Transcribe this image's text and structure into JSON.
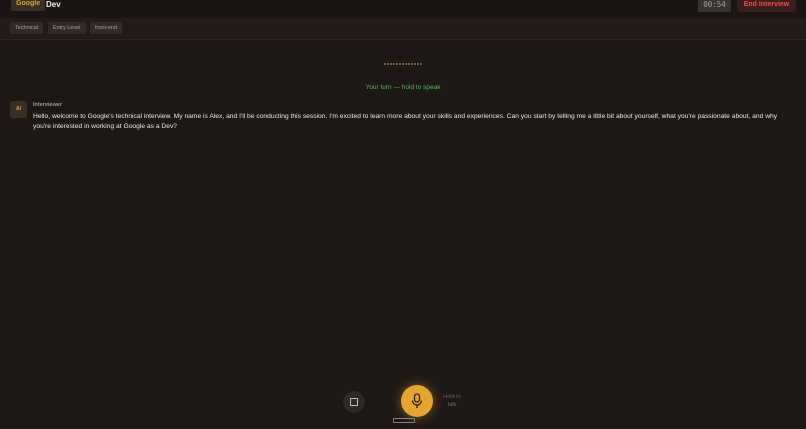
{
  "header": {
    "company": "Google",
    "role": "Dev",
    "timer": "00:54",
    "end_label": "End Interview"
  },
  "tags": [
    "Technical",
    "Entry Level",
    "front-end"
  ],
  "status": {
    "turn_text": "Your turn — hold to speak"
  },
  "transcript": {
    "avatar_label": "AI",
    "speaker": "Interviewer",
    "message": "Hello, welcome to Google's technical interview. My name is Alex, and I'll be conducting this session. I'm excited to learn more about your skills and experiences. Can you start by telling me a little bit about yourself, what you're passionate about, and why you're interested in working at Google as a Dev?"
  },
  "controls": {
    "stop_icon": "square-icon",
    "mic_icon": "microphone-icon",
    "hint_line1": "Hold to",
    "hint_line2": "talk"
  },
  "colors": {
    "accent": "#e6a531",
    "danger": "#e0524a",
    "success": "#4fc25c"
  }
}
